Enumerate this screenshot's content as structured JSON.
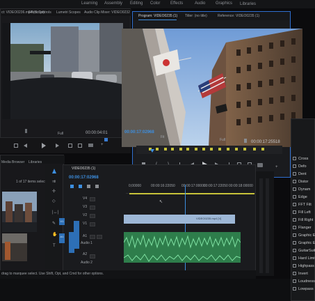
{
  "menu": {
    "items": [
      "Learning",
      "Assembly",
      "Editing",
      "Color",
      "Effects",
      "Audio",
      "Graphics",
      "Libraries"
    ]
  },
  "source_panel": {
    "tabs": [
      "ct: VIDEO0236.mp4 (Script)",
      "Effect Controls",
      "Lumetri Scopes",
      "Audio Clip Mixer: VIDEO0232"
    ],
    "timecode": "00:00:04:01",
    "resolution": "Full"
  },
  "program_monitor": {
    "tabs": [
      "Program: VIDEO0235 (1)",
      "Titler: (no title)",
      "Reference: VIDEO0235 (1)"
    ],
    "timecode_current": "00:00:17:02968",
    "fit": "Fit",
    "resolution": "Full",
    "timecode_duration": "00:00:17:25518"
  },
  "project_panel": {
    "tabs": [
      "Media Browser",
      "Libraries"
    ],
    "count": "1 of 17 items selected"
  },
  "timeline": {
    "sequence_name": "VIDEO0235 (1)",
    "timecode": "00:00:17:02968",
    "ruler": [
      "0;00000",
      "00:00:16:22050",
      "00:00:17:00000",
      "00:00:17:22050",
      "00:00:18:00000"
    ],
    "tracks_video": [
      "V4",
      "V3",
      "V2",
      "V1"
    ],
    "tracks_audio": [
      "A1",
      "A2"
    ],
    "source_tags": [
      "V1",
      "A1"
    ],
    "audio_labels": [
      "Audio 1",
      "Audio 2"
    ],
    "clip_name": "VIDEO0235.mp4 [V]"
  },
  "status_bar": {
    "text": "drag to marquee select. Use Shift, Opt, and Cmd for other options."
  },
  "effects_panel": {
    "items": [
      "Cross",
      "Defo",
      "Dent",
      "Distor",
      "Dynam",
      "Edge",
      "FFT Filt",
      "Fill Left",
      "Fill Right",
      "Flanger",
      "Graphic Eq",
      "Graphic Eq",
      "GuitarSuite",
      "Hard Limiter",
      "Highpass",
      "Invert",
      "Loudness Radar",
      "Lowpass"
    ]
  }
}
